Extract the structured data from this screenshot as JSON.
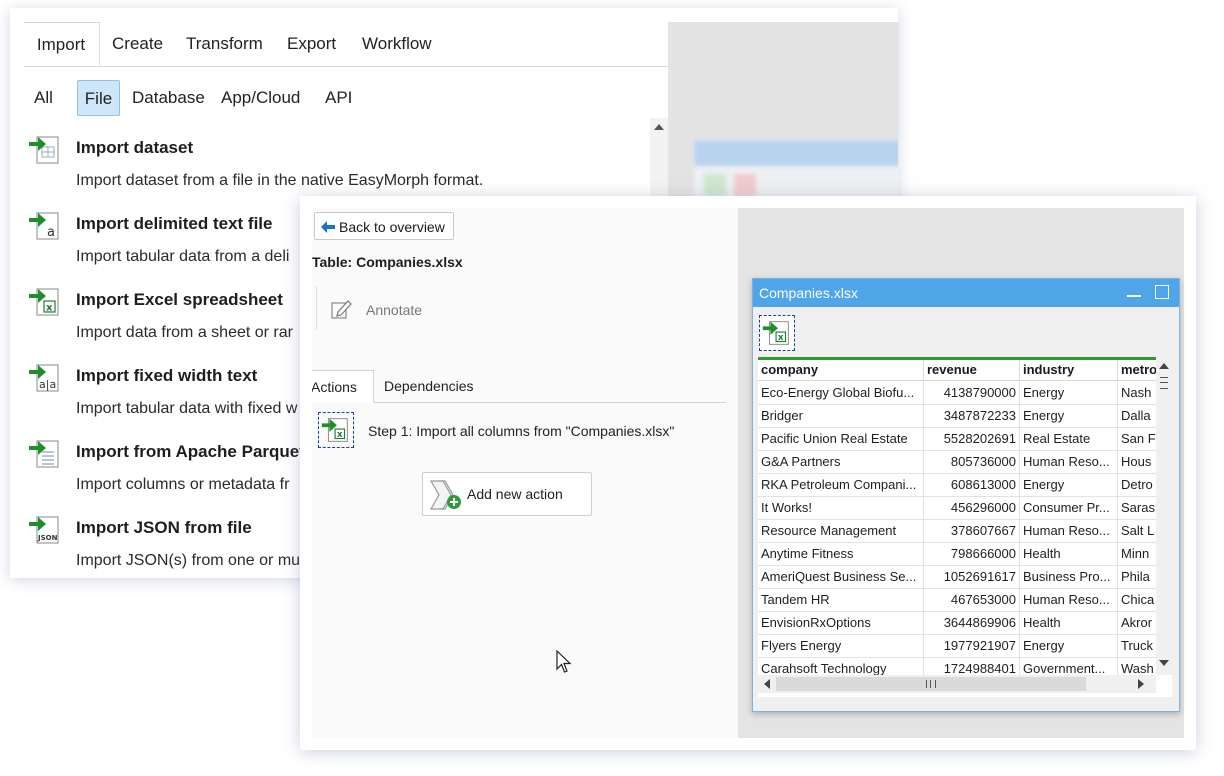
{
  "import_menu": {
    "main_tabs": [
      "Import",
      "Create",
      "Transform",
      "Export",
      "Workflow"
    ],
    "active_main_tab": "Import",
    "sub_tabs": [
      "All",
      "File",
      "Database",
      "App/Cloud",
      "API"
    ],
    "active_sub_tab": "File",
    "items": [
      {
        "icon": "import-dataset-icon",
        "title": "Import dataset",
        "desc": "Import dataset from a file in the native EasyMorph format."
      },
      {
        "icon": "import-delimited-text-icon",
        "title": "Import delimited text file",
        "desc": "Import tabular data from a deli"
      },
      {
        "icon": "import-excel-icon",
        "title": "Import Excel spreadsheet",
        "desc": "Import data from a sheet or rar"
      },
      {
        "icon": "import-fixed-width-icon",
        "title": "Import fixed width text",
        "desc": "Import tabular data with fixed w"
      },
      {
        "icon": "import-parquet-icon",
        "title": "Import from Apache Parquet",
        "desc": "Import columns or metadata fr"
      },
      {
        "icon": "import-json-icon",
        "title": "Import JSON from file",
        "desc": "Import JSON(s) from one or mu"
      }
    ]
  },
  "editor": {
    "back_button": "Back to overview",
    "table_title": "Table: Companies.xlsx",
    "annotate": "Annotate",
    "tabs": [
      "Actions",
      "Dependencies"
    ],
    "active_tab": "Actions",
    "steps": [
      {
        "label": "Step 1: Import all columns from \"Companies.xlsx\"",
        "icon": "excel-import-icon"
      }
    ],
    "add_action_button": "Add new action"
  },
  "table_window": {
    "title": "Companies.xlsx",
    "columns": [
      "company",
      "revenue",
      "industry",
      "metro"
    ],
    "rows": [
      [
        "Eco-Energy Global Biofu...",
        "4138790000",
        "Energy",
        "Nash"
      ],
      [
        "Bridger",
        "3487872233",
        "Energy",
        "Dalla"
      ],
      [
        "Pacific Union Real Estate",
        "5528202691",
        "Real Estate",
        "San F"
      ],
      [
        "G&A Partners",
        "805736000",
        "Human Reso...",
        "Hous"
      ],
      [
        "RKA Petroleum Compani...",
        "608613000",
        "Energy",
        "Detro"
      ],
      [
        "It Works!",
        "456296000",
        "Consumer Pr...",
        "Saras"
      ],
      [
        "Resource Management",
        "378607667",
        "Human Reso...",
        "Salt L"
      ],
      [
        "Anytime Fitness",
        "798666000",
        "Health",
        "Minn"
      ],
      [
        "AmeriQuest Business Se...",
        "1052691617",
        "Business Pro...",
        "Phila"
      ],
      [
        "Tandem HR",
        "467653000",
        "Human Reso...",
        "Chica"
      ],
      [
        "EnvisionRxOptions",
        "3644869906",
        "Health",
        "Akror"
      ],
      [
        "Flyers Energy",
        "1977921907",
        "Energy",
        "Truck"
      ],
      [
        "Carahsoft Technology",
        "1724988401",
        "Government...",
        "Wash"
      ]
    ]
  },
  "colors": {
    "accent_blue": "#4ea5e8",
    "active_subtab_bg": "#cfe6fa",
    "header_green": "#2f9a2f",
    "icon_green": "#1f8f2a"
  }
}
